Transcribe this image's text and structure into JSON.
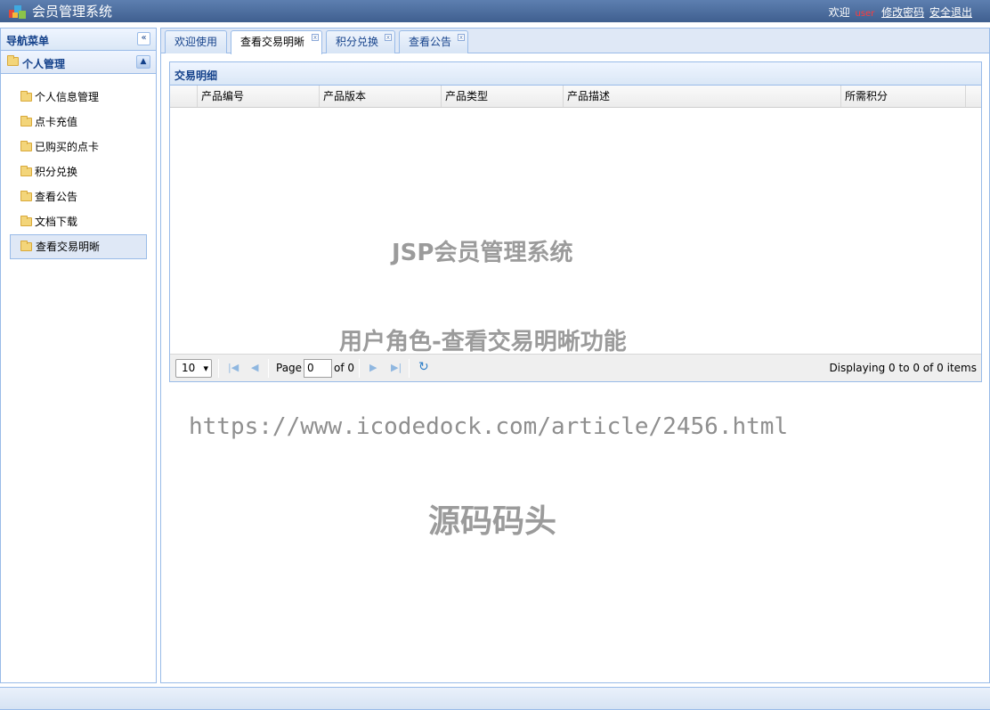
{
  "header": {
    "title": "会员管理系统",
    "welcome": "欢迎",
    "username": "user",
    "change_password": "修改密码",
    "logout": "安全退出"
  },
  "sidebar": {
    "title": "导航菜单",
    "collapse_icon": "«",
    "section": "个人管理",
    "section_toggle_icon": "▲",
    "items": [
      {
        "label": "个人信息管理"
      },
      {
        "label": "点卡充值"
      },
      {
        "label": "已购买的点卡"
      },
      {
        "label": "积分兑换"
      },
      {
        "label": "查看公告"
      },
      {
        "label": "文档下载"
      },
      {
        "label": "查看交易明晰"
      }
    ],
    "active_index": 6
  },
  "tabs": [
    {
      "label": "欢迎使用",
      "closable": false
    },
    {
      "label": "查看交易明晰",
      "closable": true,
      "active": true
    },
    {
      "label": "积分兑换",
      "closable": true
    },
    {
      "label": "查看公告",
      "closable": true
    }
  ],
  "panel": {
    "title": "交易明细",
    "columns": [
      "产品编号",
      "产品版本",
      "产品类型",
      "产品描述",
      "所需积分"
    ],
    "rows": []
  },
  "pager": {
    "page_size": "10",
    "page_label": "Page",
    "page_value": "0",
    "of_label": "of 0",
    "display_text": "Displaying 0 to 0 of 0 items"
  },
  "watermarks": {
    "line1": "JSP会员管理系统",
    "line2": "用户角色-查看交易明晰功能",
    "line3": "https://www.icodedock.com/article/2456.html",
    "line4": "源码码头"
  },
  "colors": {
    "header_bg": "#4a6a9c",
    "border": "#99bbe8",
    "title_text": "#15428b",
    "username": "#ff3b3b"
  }
}
